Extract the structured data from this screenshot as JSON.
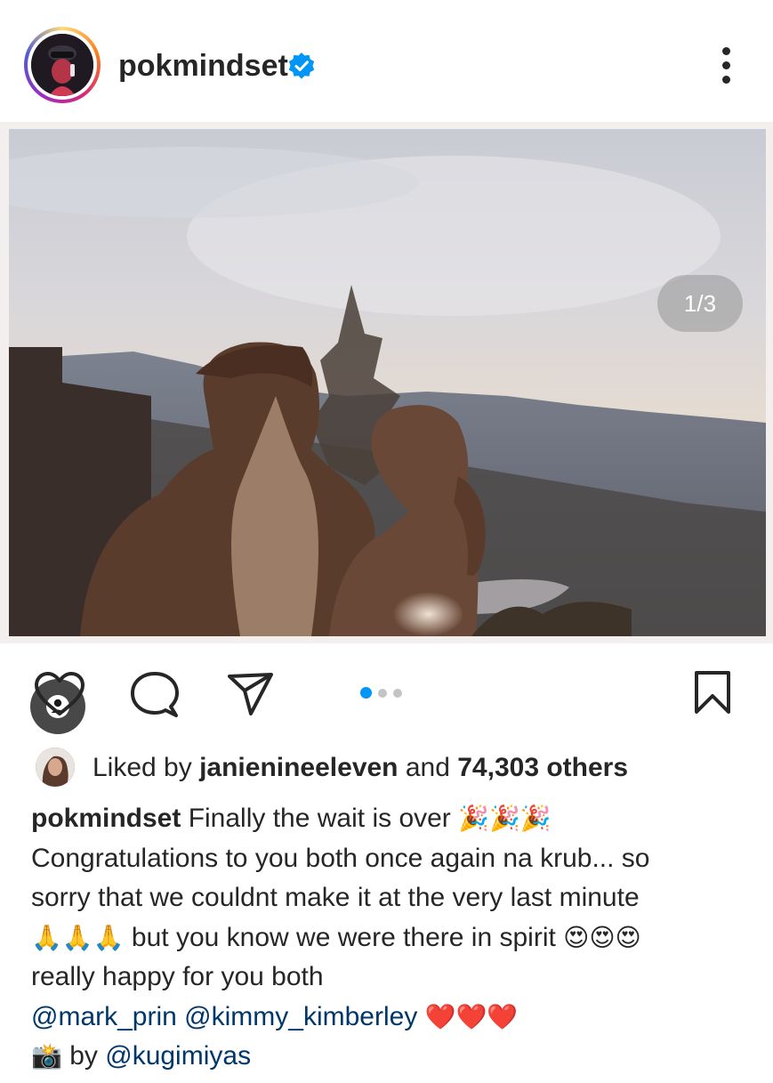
{
  "post": {
    "username": "pokmindset",
    "verified": true,
    "image_counter": "1/3",
    "carousel": {
      "total": 3,
      "active_index": 0
    }
  },
  "likes": {
    "prefix": "Liked by ",
    "liker": "janienineeleven",
    "middle": " and ",
    "others": "74,303 others"
  },
  "caption": {
    "username": "pokmindset",
    "line1_text": " Finally the wait is over ",
    "line1_emoji": "🎉🎉🎉",
    "line2": "Congratulations to you both once again na krub... so",
    "line3": "sorry that we couldnt make it at the very last minute",
    "line4_emoji_a": "🙏🙏🙏",
    "line4_text": " but you know we were there in spirit ",
    "line4_emoji_b": "😍😍😍",
    "line5": "really happy for you both",
    "mention1": "@mark_prin",
    "mention2": "@kimmy_kimberley",
    "hearts": "❤️❤️❤️",
    "camera_emoji": "📸",
    "credit_text": " by ",
    "credit_mention": "@kugimiyas"
  },
  "colors": {
    "accent_blue": "#0095f6",
    "mention_blue": "#00376b",
    "text": "#262626"
  }
}
